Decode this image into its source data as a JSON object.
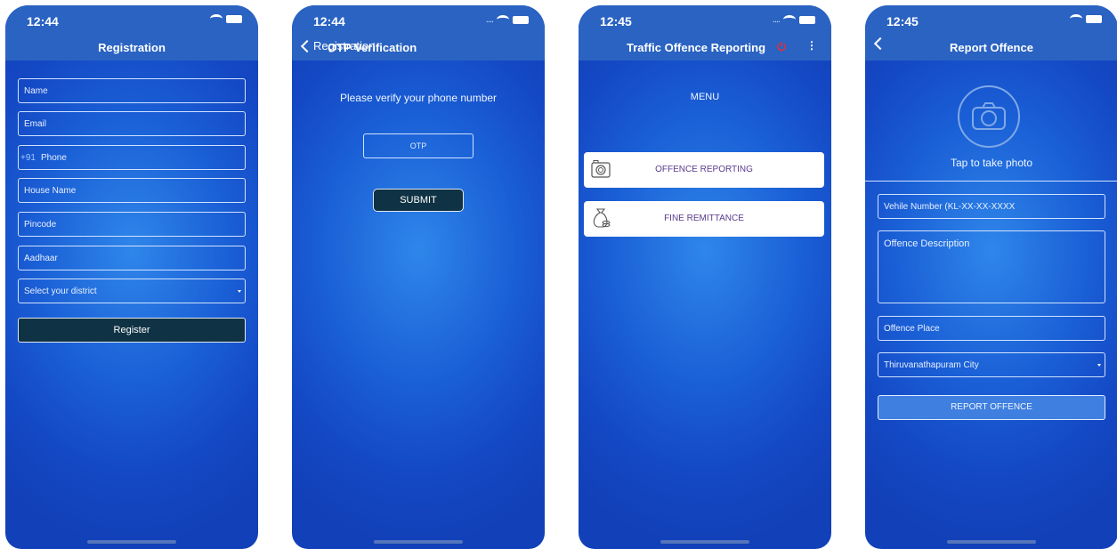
{
  "screen1": {
    "time": "12:44",
    "title": "Registration",
    "fields": {
      "name": "Name",
      "email": "Email",
      "country_code": "+91",
      "phone": "Phone",
      "house_name": "House Name",
      "pincode": "Pincode",
      "aadhaar": "Aadhaar",
      "district": "Select your district"
    },
    "register_button": "Register"
  },
  "screen2": {
    "time": "12:44",
    "back_label": "Registration",
    "title": "OTP Verification",
    "prompt": "Please verify your phone number",
    "otp_placeholder": "OTP",
    "submit_button": "SUBMIT"
  },
  "screen3": {
    "time": "12:45",
    "title": "Traffic Offence Reporting",
    "menu_heading": "MENU",
    "menu_items": [
      "OFFENCE REPORTING",
      "FINE REMITTANCE"
    ]
  },
  "screen4": {
    "time": "12:45",
    "title": "Report Offence",
    "photo_label": "Tap to take photo",
    "vehicle_placeholder": "Vehile Number (KL-XX-XX-XXXX",
    "description_placeholder": "Offence Description",
    "place_placeholder": "Offence Place",
    "district_value": "Thiruvanathapuram City",
    "report_button": "REPORT OFFENCE"
  },
  "colors": {
    "power_icon": "#e0303c",
    "accent_blue": "#2a63c2",
    "dark_button": "#0f3244"
  }
}
